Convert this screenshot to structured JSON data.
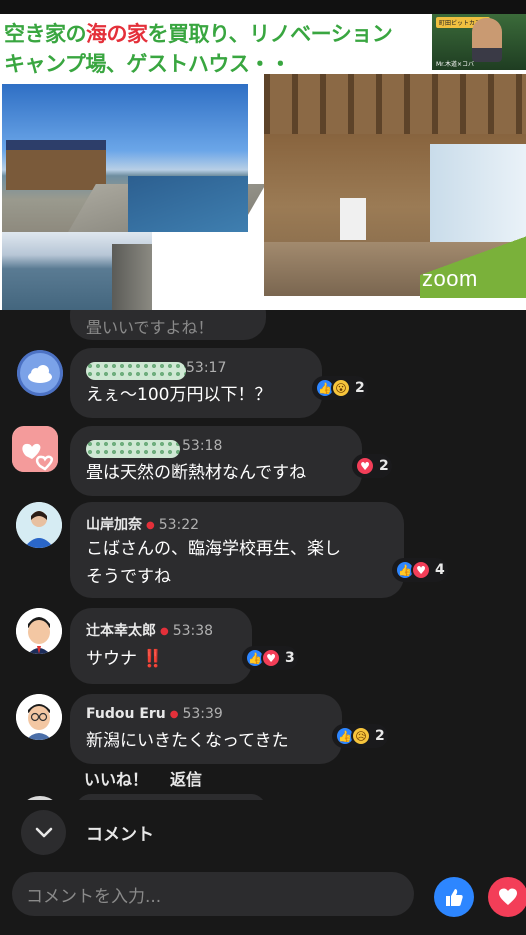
{
  "video": {
    "title_line1_part1": "空き家の",
    "title_line1_red": "海の家",
    "title_line1_part2": "を買取り、リノベーション",
    "title_line2": "キャンプ場、ゲストハウス・・",
    "watermark": "zoom",
    "camera_badge": "町田ビットカフェ",
    "camera_name": "Mr.木道×コバ"
  },
  "chat": {
    "partial_top_text": "畳いいですよね！",
    "comments": [
      {
        "author": "",
        "time": "53:17",
        "text": "えぇ〜100万円以下！？",
        "reactions": [
          "like",
          "wow"
        ],
        "count": "2"
      },
      {
        "author": "",
        "time": "53:18",
        "text": "畳は天然の断熱材なんですね",
        "reactions": [
          "love"
        ],
        "count": "2"
      },
      {
        "author": "山岸加奈",
        "time": "53:22",
        "text_line1": "こばさんの、臨海学校再生、楽し",
        "text_line2": "そうですね",
        "reactions": [
          "like",
          "love"
        ],
        "count": "4"
      },
      {
        "author": "辻本幸太郎",
        "time": "53:38",
        "text": "サウナ",
        "emoji": "‼️",
        "reactions": [
          "like",
          "love"
        ],
        "count": "3"
      },
      {
        "author": "Fudou Eru",
        "time": "53:39",
        "text": "新潟にいきたくなってきた",
        "reactions": [
          "like",
          "wow"
        ],
        "count": "2"
      }
    ],
    "actions": {
      "like": "いいね！",
      "reply": "返信"
    }
  },
  "footer": {
    "comments_label": "コメント",
    "input_placeholder": "コメントを入力..."
  },
  "colors": {
    "accent_like": "#2d86ff",
    "accent_love": "#f33e58",
    "title_green": "#39a640",
    "title_red": "#e4303a"
  }
}
